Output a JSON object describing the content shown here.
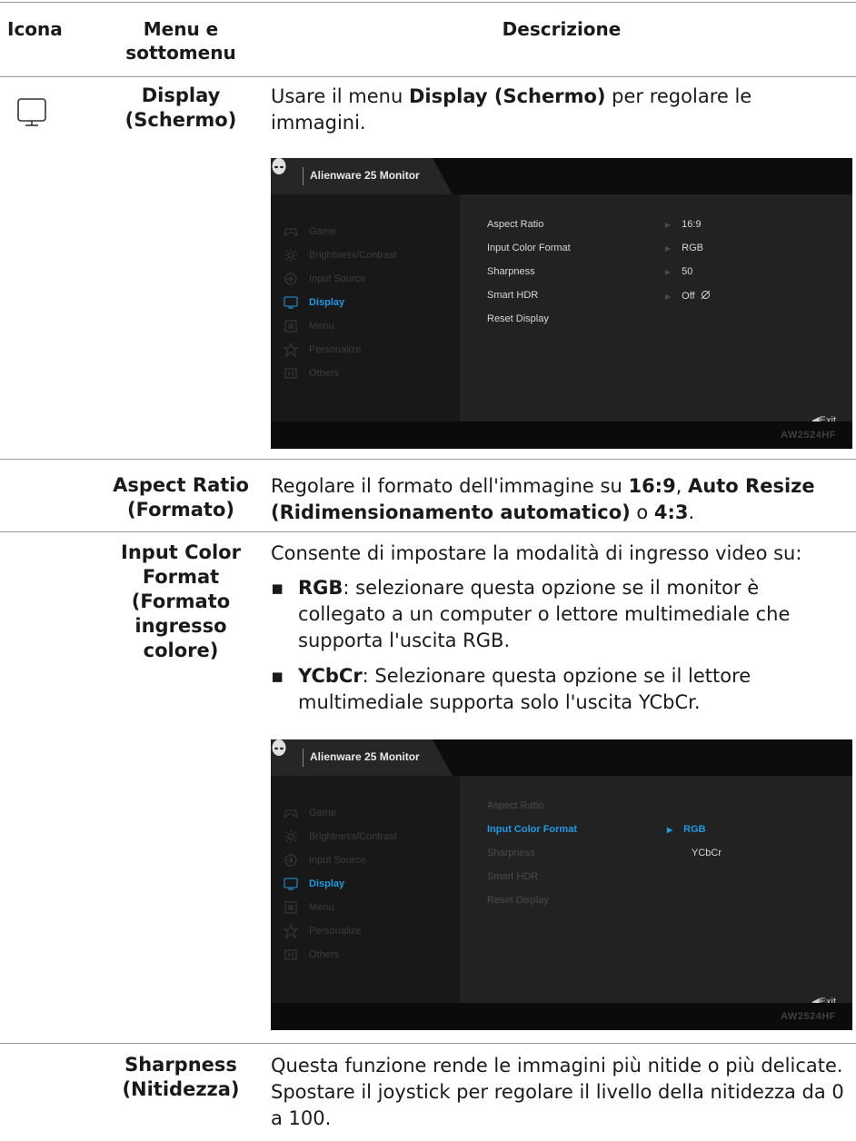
{
  "table": {
    "headers": {
      "icon": "Icona",
      "menu": "Menu e sottomenu",
      "description": "Descrizione"
    }
  },
  "display": {
    "menu_label": "Display (Schermo)",
    "icon": "monitor-icon",
    "desc_pre": "Usare il menu ",
    "desc_bold": "Display (Schermo)",
    "desc_post": " per regolare le immagini."
  },
  "osd1": {
    "title": "Alienware 25 Monitor",
    "model": "AW2524HF",
    "exit": "◀Exit",
    "menu_items": [
      "Game",
      "Brightness/Contrast",
      "Input Source",
      "Display",
      "Menu",
      "Personalize",
      "Others"
    ],
    "menu_icons": [
      "gamepad-icon",
      "brightness-icon",
      "input-source-icon",
      "monitor-icon",
      "menu-icon",
      "star-icon",
      "others-icon"
    ],
    "active_item": "Display",
    "options": [
      "Aspect Ratio",
      "Input Color Format",
      "Sharpness",
      "Smart HDR",
      "Reset Display"
    ],
    "values": [
      "16:9",
      "RGB",
      "50",
      "Off"
    ],
    "leaf_icon": "no-hdr-icon"
  },
  "aspect": {
    "menu_label": "Aspect Ratio (Formato)",
    "t1": "Regolare il formato dell'immagine su ",
    "b1": "16:9",
    "t2": ", ",
    "b2": "Auto Resize (Ridimensionamento automatico)",
    "t3": " o ",
    "b3": "4:3",
    "t4": "."
  },
  "icf": {
    "menu_label": "Input Color Format (Formato ingresso colore)",
    "intro": "Consente di impostare la modalità di ingresso video su:",
    "bullets": [
      {
        "bold": "RGB",
        "text": ": selezionare questa opzione se il monitor è collegato a un computer o lettore multimediale che supporta l'uscita RGB."
      },
      {
        "bold": "YCbCr",
        "text": ": Selezionare questa opzione se il lettore multimediale supporta solo l'uscita YCbCr."
      }
    ]
  },
  "osd2": {
    "title": "Alienware 25 Monitor",
    "model": "AW2524HF",
    "exit": "◀Exit",
    "menu_items": [
      "Game",
      "Brightness/Contrast",
      "Input Source",
      "Display",
      "Menu",
      "Personalize",
      "Others"
    ],
    "active_item": "Display",
    "options": [
      "Aspect Ratio",
      "Input Color Format",
      "Sharpness",
      "Smart HDR",
      "Reset Display"
    ],
    "selected_option": "Input Color Format",
    "sub_values": [
      "RGB",
      "YCbCr"
    ],
    "selected_value": "RGB"
  },
  "sharpness": {
    "menu_label": "Sharpness (Nitidezza)",
    "desc": "Questa funzione rende le immagini più nitide o più delicate. Spostare il joystick per regolare il livello della nitidezza da 0 a 100."
  }
}
